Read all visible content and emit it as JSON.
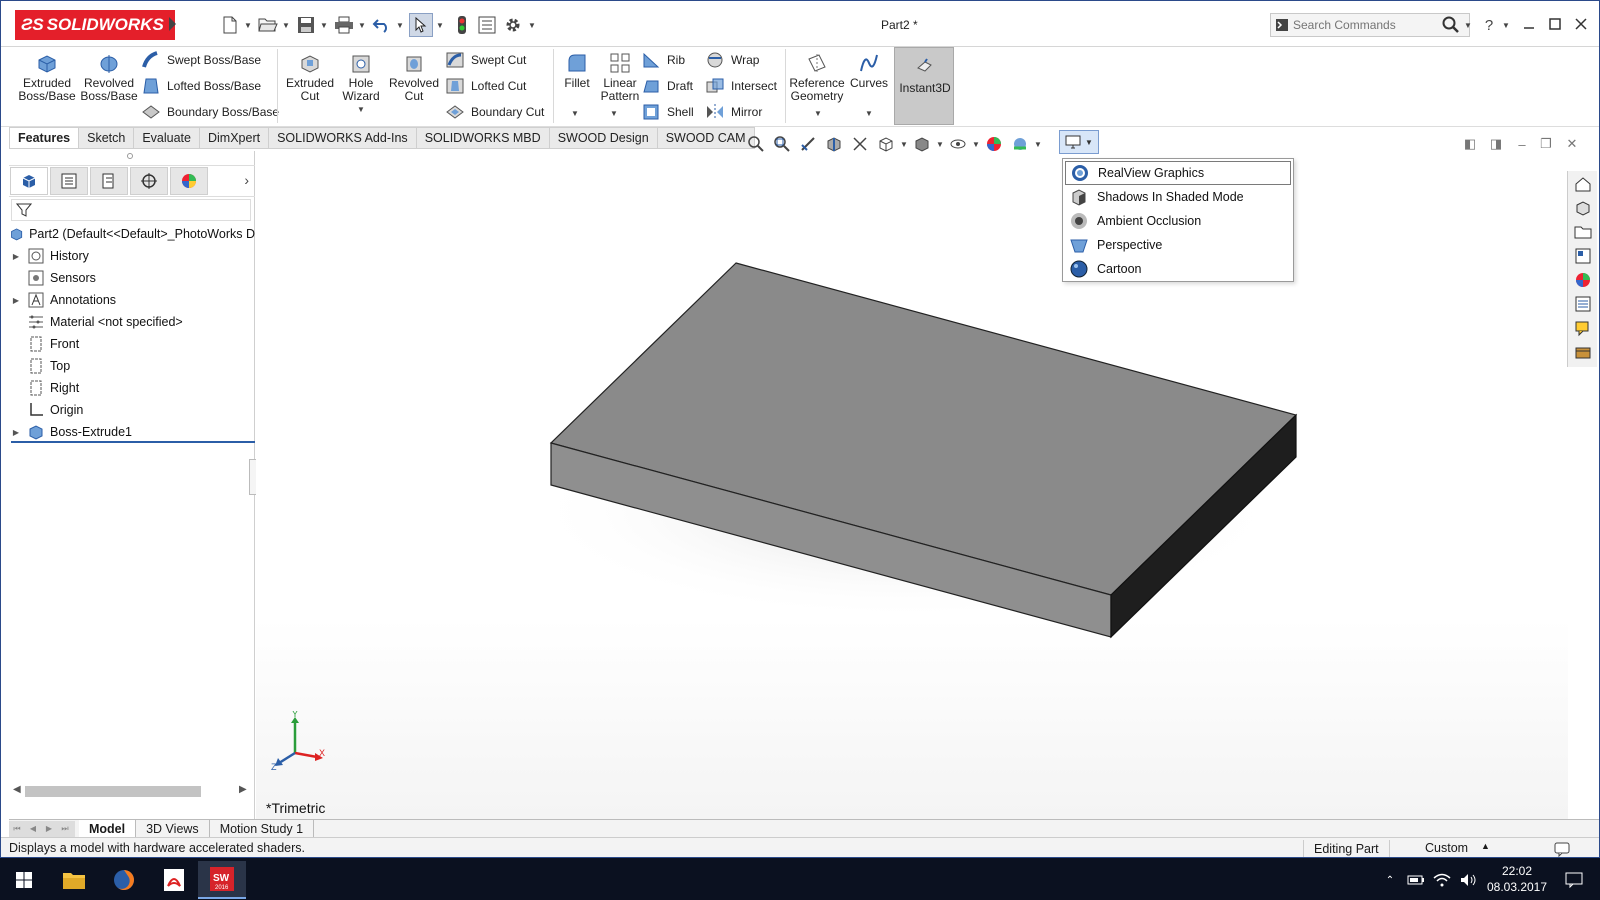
{
  "titlebar": {
    "logo_text": "SOLIDWORKS",
    "document_title": "Part2 *",
    "search_placeholder": "Search Commands",
    "help_label": "?"
  },
  "ribbon": {
    "extruded_boss": "Extruded\nBoss/Base",
    "revolved_boss": "Revolved\nBoss/Base",
    "swept_boss": "Swept Boss/Base",
    "lofted_boss": "Lofted Boss/Base",
    "boundary_boss": "Boundary Boss/Base",
    "extruded_cut": "Extruded\nCut",
    "hole_wizard": "Hole\nWizard",
    "revolved_cut": "Revolved\nCut",
    "swept_cut": "Swept Cut",
    "lofted_cut": "Lofted Cut",
    "boundary_cut": "Boundary Cut",
    "fillet": "Fillet",
    "linear_pattern": "Linear\nPattern",
    "rib": "Rib",
    "draft": "Draft",
    "shell": "Shell",
    "wrap": "Wrap",
    "intersect": "Intersect",
    "mirror": "Mirror",
    "reference_geometry": "Reference\nGeometry",
    "curves": "Curves",
    "instant3d": "Instant3D"
  },
  "tabs": [
    "Features",
    "Sketch",
    "Evaluate",
    "DimXpert",
    "SOLIDWORKS Add-Ins",
    "SOLIDWORKS MBD",
    "SWOOD Design",
    "SWOOD CAM"
  ],
  "tree": {
    "root": "Part2  (Default<<Default>_PhotoWorks D",
    "items": [
      "History",
      "Sensors",
      "Annotations",
      "Material <not specified>",
      "Front",
      "Top",
      "Right",
      "Origin",
      "Boss-Extrude1"
    ]
  },
  "display_menu": {
    "items": [
      "RealView Graphics",
      "Shadows In Shaded Mode",
      "Ambient Occlusion",
      "Perspective",
      "Cartoon"
    ]
  },
  "viewport": {
    "view_name": "*Trimetric",
    "axis_x": "X",
    "axis_y": "Y",
    "axis_z": "Z"
  },
  "bottom_tabs": [
    "Model",
    "3D Views",
    "Motion Study 1"
  ],
  "status": {
    "message": "Displays a model with hardware accelerated shaders.",
    "mode": "Editing Part",
    "units": "Custom"
  },
  "taskbar": {
    "time": "22:02",
    "date": "08.03.2017",
    "sw_badge": "2016"
  },
  "colors": {
    "brand_red": "#e41f2a",
    "selection_blue": "#2b5ea7",
    "taskbar_bg": "#0b1120"
  }
}
